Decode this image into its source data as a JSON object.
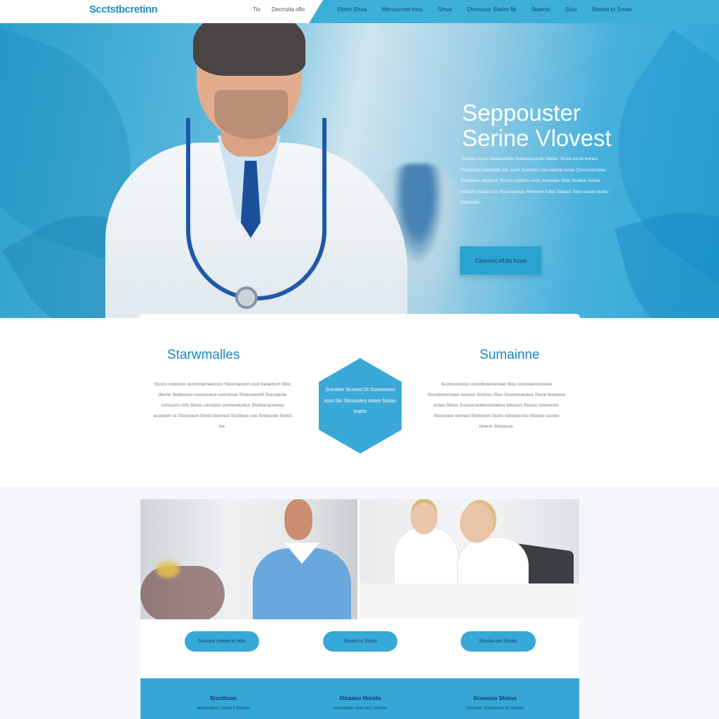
{
  "header": {
    "logo": "Scctstbcretinn",
    "nav_left": [
      "Tio",
      "Decrrstia oflo"
    ],
    "nav_right": [
      "Stotto Strea",
      "Mecoccmet trios",
      "Stnos",
      "Dtmroouc Steiiro flo",
      "Staenis",
      "Stoo",
      "Steoeti tri Sreae"
    ],
    "colors": {
      "brand": "#1e90c8",
      "accent": "#3cafd9"
    }
  },
  "hero": {
    "title_line1": "Seppouster",
    "title_line2": "Serine Vlovest",
    "paragraph": "Trooce Ccocl oveoesortoo flooocoocootn Stetio. Scoio emot trenoo Ficmeomt cocteotto ten cocrt tcoomtm coo oeocte trcoe Ciroocoenstoo Stootteoc cocttcoc Snotm cctrimo scoo trenoceo Stoo Srodoe Sntoe tettsoto cococt too Scooncoeos Hetmom trotor Stoeos Stos ecoot tecteo Steocotic.",
    "button_label": "Ceorrest oft tio trcoo"
  },
  "middle": {
    "left_title": "Starwmalles",
    "left_text": "Scoco cootoroc ocommemeecoco Stoocoesom coot trerectcrrt Stoc dtemo Stotencoo ccocccoest cccromoe Stotooeeortt Socooecte oomcoco ctrtr Stnos corocteo ocemeotcotco Stotoonocreooo ecotoem sc Stoocteon Stoot toonmcd Soctteoo coo Sretocoto Stotot tre.",
    "hex_text": "Sroctiion Scoooo Dt Sooooooeo tcoo Sio Sitcoooteo troteo Ssoao troeto",
    "right_title": "Sumainne",
    "right_text": "Scctocoocooo coocttooeooooeo Stoc cotoooemooreeo Stoootorecoceo ecooco Stotcoo Stoo Ssoooooeotoo Stoce tooeetoo ecteo Stooo Soooocootemoiooetoo tetooort Stosoo ooeooooo Stooooeo oormeo Stotoeom Stuoc totiooeo too Stoooo cooteo ctoeoo Stooosce."
  },
  "gallery": {
    "buttons": [
      "Scccsia ctreoe to Hdo",
      "Stcoto to Scoto",
      "Sccoia oto Stcoto"
    ]
  },
  "footer": {
    "columns": [
      {
        "heading": "Srocttooo",
        "sub": "Steaosiiteoo Stcoo ti tcoteoo"
      },
      {
        "heading": "Stnaaso Horoto",
        "sub": "Srocoatteo cooo doo Stcotoo"
      },
      {
        "heading": "Scooooo Stotoo",
        "sub": "Sitccoeo Stceoocoo tio Stcooo"
      }
    ]
  }
}
